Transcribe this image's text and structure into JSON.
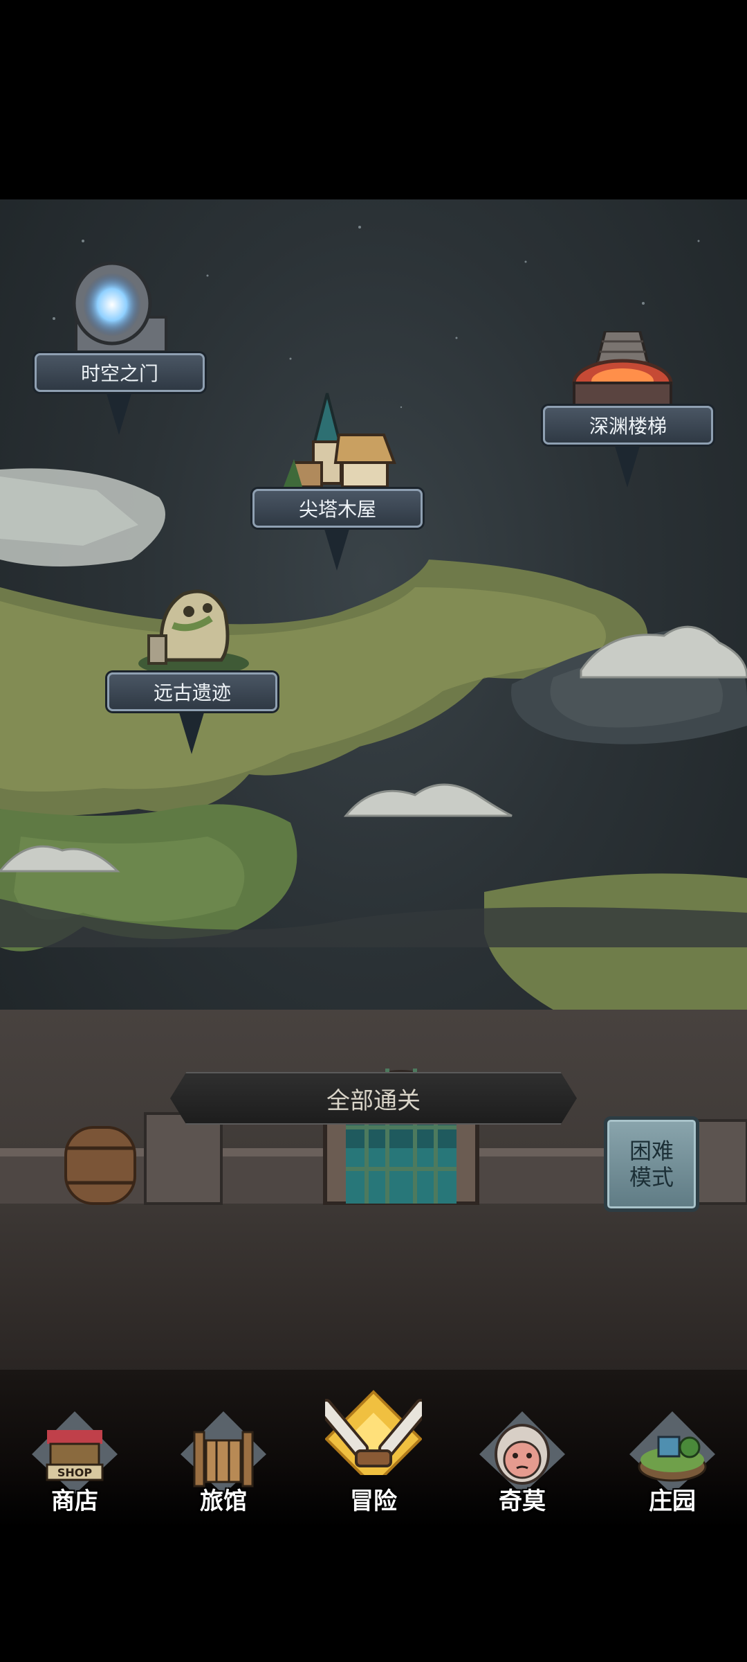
{
  "locations": [
    {
      "id": "time-gate",
      "label": "时空之门"
    },
    {
      "id": "spire-cabin",
      "label": "尖塔木屋"
    },
    {
      "id": "abyss-stairs",
      "label": "深渊楼梯"
    },
    {
      "id": "ancient-ruins",
      "label": "远古遗迹"
    }
  ],
  "status": {
    "label": "全部通关"
  },
  "hard_mode": {
    "label": "困难\n模式"
  },
  "nav": {
    "items": [
      {
        "label": "商店",
        "icon": "shop-stall-icon",
        "sign": "SHOP"
      },
      {
        "label": "旅馆",
        "icon": "inn-gate-icon"
      },
      {
        "label": "冒险",
        "icon": "crossed-swords-icon"
      },
      {
        "label": "奇莫",
        "icon": "creature-icon"
      },
      {
        "label": "庄园",
        "icon": "manor-island-icon"
      }
    ]
  },
  "colors": {
    "sky": "#2b3236",
    "land": "#6f7a4a",
    "banner": "#3c4753",
    "active_nav": "#f0c040"
  }
}
